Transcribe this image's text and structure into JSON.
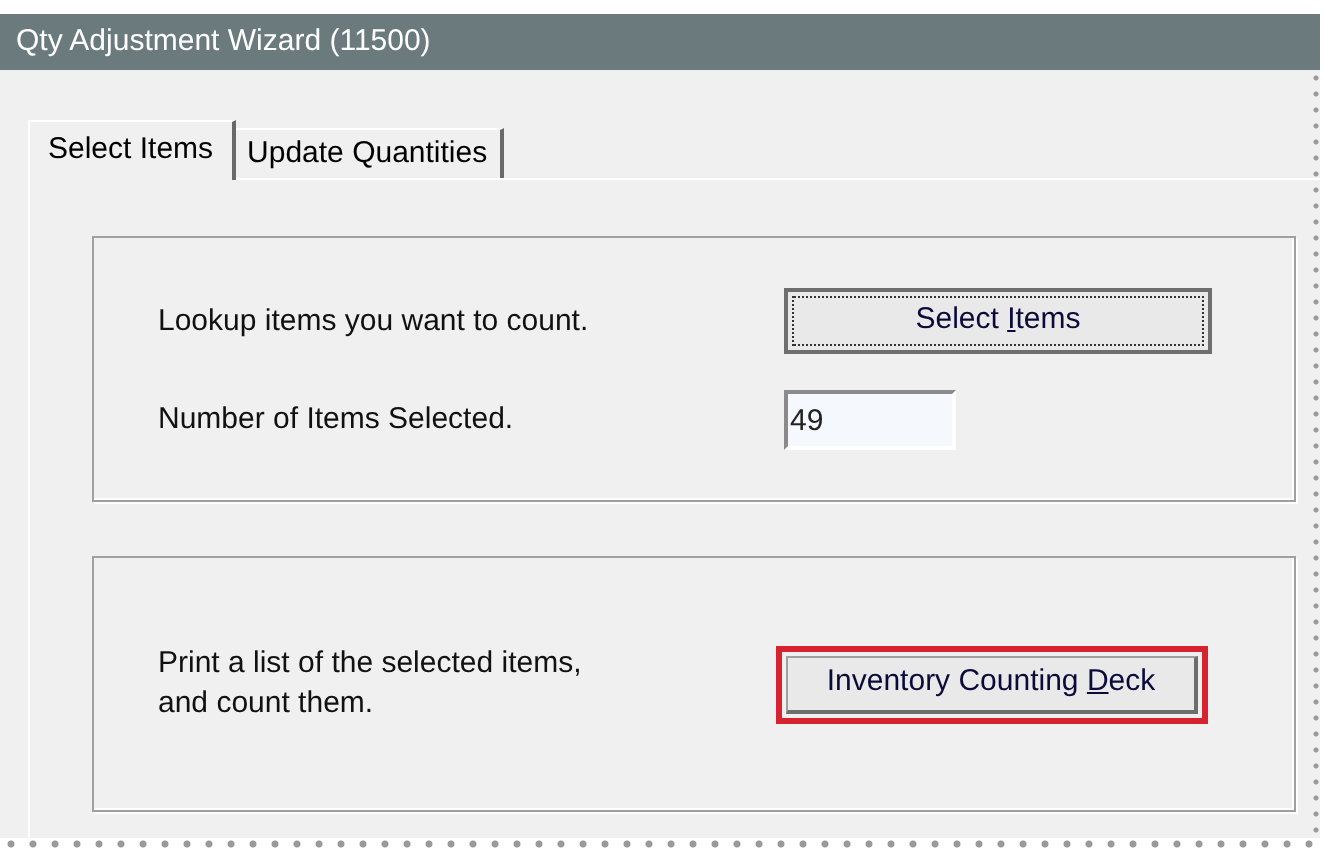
{
  "window": {
    "title": "Qty Adjustment Wizard (11500)"
  },
  "tabs": [
    {
      "label": "Select Items",
      "selected": true
    },
    {
      "label": "Update Quantities",
      "selected": false
    }
  ],
  "groups": [
    {
      "rows": [
        {
          "kind": "button",
          "text": "Lookup items you want to count.",
          "button": {
            "label_before": "Select ",
            "access_key": "I",
            "label_after": "tems",
            "focused": true,
            "highlighted": false
          }
        },
        {
          "kind": "field",
          "text": "Number of Items Selected.",
          "value": "49"
        }
      ]
    },
    {
      "rows": [
        {
          "kind": "button",
          "text": "Print a list of the selected items,\nand count them.",
          "button": {
            "label_before": "Inventory Counting ",
            "access_key": "D",
            "label_after": "eck",
            "focused": false,
            "highlighted": true
          }
        }
      ]
    }
  ]
}
